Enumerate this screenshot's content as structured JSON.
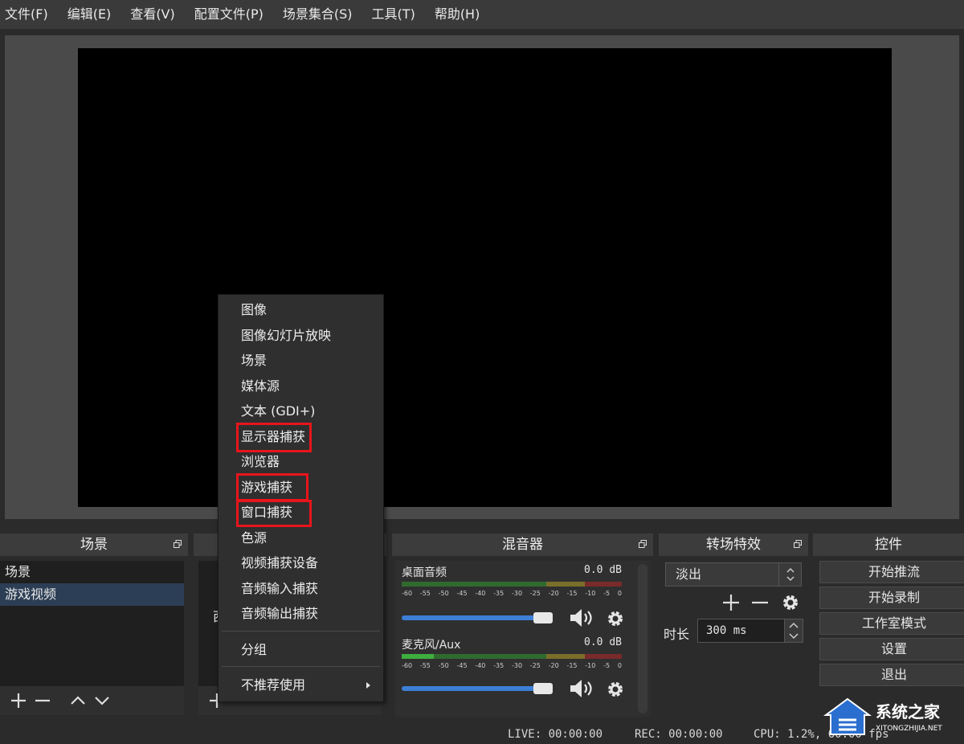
{
  "menubar": {
    "items": [
      "文件(F)",
      "编辑(E)",
      "查看(V)",
      "配置文件(P)",
      "场景集合(S)",
      "工具(T)",
      "帮助(H)"
    ]
  },
  "scenes": {
    "title": "场景",
    "items": [
      "场景",
      "游戏视频"
    ],
    "selected_index": 1
  },
  "sources": {
    "partial_text": "西"
  },
  "mixer": {
    "title": "混音器",
    "channels": [
      {
        "name": "桌面音频",
        "db": "0.0 dB",
        "volume": 1.0
      },
      {
        "name": "麦克风/Aux",
        "db": "0.0 dB",
        "volume": 1.0
      }
    ],
    "scale": [
      "-60",
      "-55",
      "-50",
      "-45",
      "-40",
      "-35",
      "-30",
      "-25",
      "-20",
      "-15",
      "-10",
      "-5",
      "0"
    ]
  },
  "transitions": {
    "title": "转场特效",
    "selected": "淡出",
    "duration_label": "时长",
    "duration_value": "300 ms"
  },
  "controls": {
    "title": "控件",
    "buttons": [
      "开始推流",
      "开始录制",
      "工作室模式",
      "设置",
      "退出"
    ]
  },
  "status": {
    "live": "LIVE: 00:00:00",
    "rec": "REC: 00:00:00",
    "cpu": "CPU: 1.2%, 60.00 fps"
  },
  "context_menu": {
    "items": [
      "图像",
      "图像幻灯片放映",
      "场景",
      "媒体源",
      "文本 (GDI+)",
      "显示器捕获",
      "浏览器",
      "游戏捕获",
      "窗口捕获",
      "色源",
      "视频捕获设备",
      "音频输入捕获",
      "音频输出捕获"
    ],
    "group": "分组",
    "deprecated": "不推荐使用",
    "highlighted": [
      "显示器捕获",
      "游戏捕获",
      "窗口捕获"
    ]
  },
  "watermark": {
    "text": "系统之家",
    "url": "XITONGZHIJIA.NET"
  },
  "colors": {
    "highlight_box": "#e8151b",
    "selected_row": "#2c3e55",
    "slider": "#3d7fd6",
    "meter_green": "#3fae3f",
    "meter_yellow": "#b8a640",
    "meter_red": "#b83a3a"
  }
}
